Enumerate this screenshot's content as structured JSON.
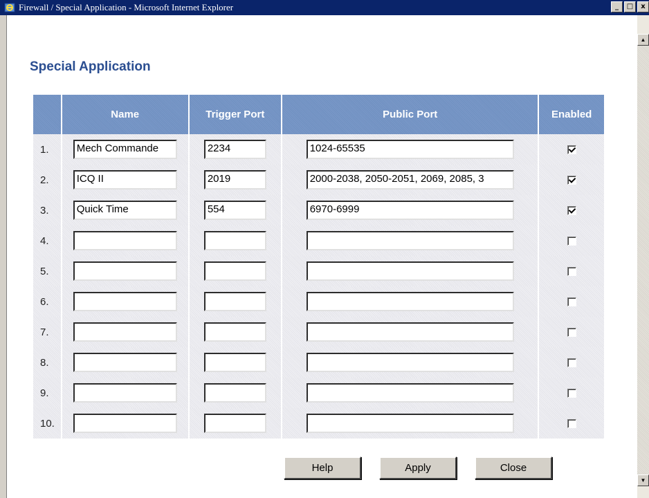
{
  "window": {
    "title": "Firewall / Special Application - Microsoft Internet Explorer",
    "minimize": "_",
    "maximize": "□",
    "close": "x"
  },
  "page": {
    "title": "Special Application"
  },
  "table": {
    "headers": [
      "",
      "Name",
      "Trigger Port",
      "Public Port",
      "Enabled"
    ],
    "rows": [
      {
        "num": "1.",
        "name": "Mech Commande",
        "trigger": "2234",
        "public": "1024-65535",
        "enabled": true
      },
      {
        "num": "2.",
        "name": "ICQ II",
        "trigger": "2019",
        "public": "2000-2038, 2050-2051, 2069, 2085, 3",
        "enabled": true
      },
      {
        "num": "3.",
        "name": "Quick Time",
        "trigger": "554",
        "public": "6970-6999",
        "enabled": true
      },
      {
        "num": "4.",
        "name": "",
        "trigger": "",
        "public": "",
        "enabled": false
      },
      {
        "num": "5.",
        "name": "",
        "trigger": "",
        "public": "",
        "enabled": false
      },
      {
        "num": "6.",
        "name": "",
        "trigger": "",
        "public": "",
        "enabled": false
      },
      {
        "num": "7.",
        "name": "",
        "trigger": "",
        "public": "",
        "enabled": false
      },
      {
        "num": "8.",
        "name": "",
        "trigger": "",
        "public": "",
        "enabled": false
      },
      {
        "num": "9.",
        "name": "",
        "trigger": "",
        "public": "",
        "enabled": false
      },
      {
        "num": "10.",
        "name": "",
        "trigger": "",
        "public": "",
        "enabled": false
      }
    ]
  },
  "buttons": {
    "help": "Help",
    "apply": "Apply",
    "close": "Close"
  },
  "colors": {
    "title_text": "#2b4e91",
    "header_bg": "#7394c6",
    "titlebar": "#0a246a"
  }
}
